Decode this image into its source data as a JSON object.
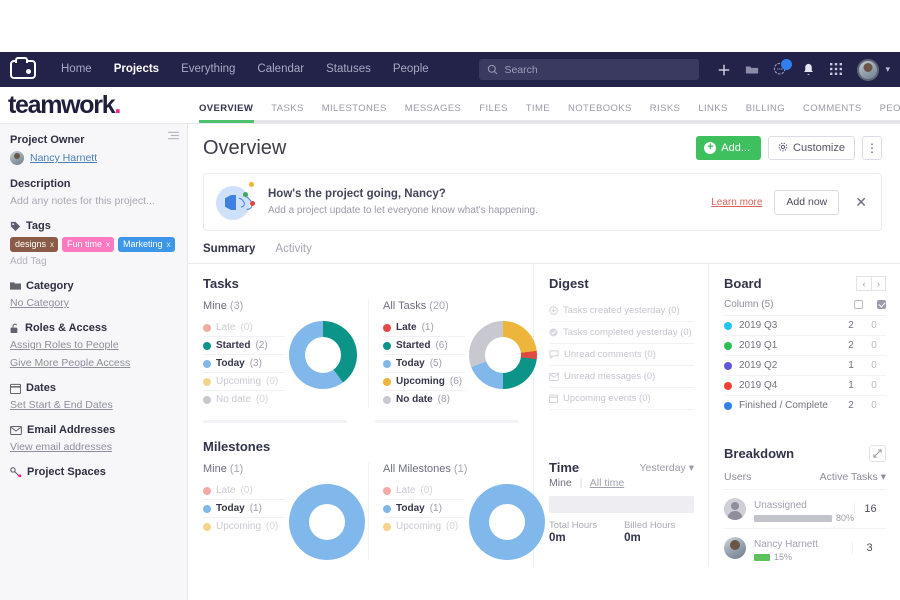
{
  "topnav": {
    "logo_icon": "teamwork-box-icon",
    "items": [
      {
        "label": "Home",
        "active": false
      },
      {
        "label": "Projects",
        "active": true
      },
      {
        "label": "Everything",
        "active": false
      },
      {
        "label": "Calendar",
        "active": false
      },
      {
        "label": "Statuses",
        "active": false
      },
      {
        "label": "People",
        "active": false
      }
    ],
    "search": {
      "placeholder": "Search",
      "value": ""
    },
    "icons": [
      "plus-icon",
      "folder-icon",
      "chat-icon",
      "bell-icon",
      "grid-apps-icon"
    ],
    "notification_badge": true
  },
  "brand": {
    "name": "teamwork",
    "dot": "."
  },
  "project_tabs": [
    {
      "label": "OVERVIEW",
      "active": true
    },
    {
      "label": "TASKS",
      "active": false
    },
    {
      "label": "MILESTONES",
      "active": false
    },
    {
      "label": "MESSAGES",
      "active": false
    },
    {
      "label": "FILES",
      "active": false
    },
    {
      "label": "TIME",
      "active": false
    },
    {
      "label": "NOTEBOOKS",
      "active": false
    },
    {
      "label": "RISKS",
      "active": false
    },
    {
      "label": "LINKS",
      "active": false
    },
    {
      "label": "BILLING",
      "active": false
    },
    {
      "label": "COMMENTS",
      "active": false
    },
    {
      "label": "PEOPLE",
      "active": false
    },
    {
      "label": "•••",
      "active": false
    }
  ],
  "sidebar": {
    "project_owner": {
      "heading": "Project Owner",
      "name": "Nancy Harnett"
    },
    "description": {
      "heading": "Description",
      "placeholder": "Add any notes for this project..."
    },
    "tags": {
      "heading": "Tags",
      "items": [
        {
          "label": "designs",
          "color": "#8a5c48"
        },
        {
          "label": "Fun time",
          "color": "#fb79bf"
        },
        {
          "label": "Marketing",
          "color": "#3d97e8"
        }
      ],
      "add_label": "Add Tag"
    },
    "category": {
      "heading": "Category",
      "value": "No Category"
    },
    "roles": {
      "heading": "Roles & Access",
      "links": [
        "Assign Roles to People",
        "Give More People Access"
      ]
    },
    "dates": {
      "heading": "Dates",
      "links": [
        "Set Start & End Dates"
      ]
    },
    "email": {
      "heading": "Email Addresses",
      "links": [
        "View email addresses"
      ]
    },
    "spaces": {
      "heading": "Project Spaces"
    }
  },
  "page": {
    "title": "Overview",
    "add_label": "Add...",
    "customize_label": "Customize",
    "kebab_label": "⋮"
  },
  "banner": {
    "title": "How's the project going, Nancy?",
    "subtitle": "Add a project update to let everyone know what's happening.",
    "learn_more": "Learn more",
    "add_now": "Add now",
    "close": "✕"
  },
  "summary_tabs": [
    {
      "label": "Summary",
      "active": true
    },
    {
      "label": "Activity",
      "active": false
    }
  ],
  "chart_data": [
    {
      "type": "pie",
      "title": "Tasks",
      "subtitle": "Mine",
      "total_label": "(3)",
      "categories": [
        "Late",
        "Started",
        "Today",
        "Upcoming",
        "No date"
      ],
      "values": [
        0,
        2,
        3,
        0,
        0
      ],
      "colors": [
        "#f3a9a4",
        "#0c9488",
        "#81b8ec",
        "#f5d48b",
        "#c8c8d0"
      ],
      "legend": "left",
      "donut": true
    },
    {
      "type": "pie",
      "title": "Tasks",
      "subtitle": "All Tasks",
      "total_label": "(20)",
      "categories": [
        "Late",
        "Started",
        "Today",
        "Upcoming",
        "No date"
      ],
      "values": [
        1,
        6,
        5,
        6,
        8
      ],
      "colors": [
        "#e04a42",
        "#0c9488",
        "#81b8ec",
        "#edb53c",
        "#c8c8d0"
      ],
      "legend": "left",
      "donut": true
    },
    {
      "type": "pie",
      "title": "Milestones",
      "subtitle": "Mine",
      "total_label": "(1)",
      "categories": [
        "Late",
        "Today",
        "Upcoming"
      ],
      "values": [
        0,
        1,
        0
      ],
      "colors": [
        "#f3a9a4",
        "#81b8ec",
        "#f5d48b"
      ],
      "legend": "left",
      "donut": true
    },
    {
      "type": "pie",
      "title": "Milestones",
      "subtitle": "All Milestones",
      "total_label": "(1)",
      "categories": [
        "Late",
        "Today",
        "Upcoming"
      ],
      "values": [
        0,
        1,
        0
      ],
      "colors": [
        "#f3a9a4",
        "#81b8ec",
        "#f5d48b"
      ],
      "legend": "left",
      "donut": true
    }
  ],
  "tasks": {
    "title": "Tasks",
    "mine": {
      "label": "Mine",
      "count": "(3)",
      "rows": [
        {
          "name": "Late",
          "value": "(0)",
          "color": "#f3a9a4",
          "active": false
        },
        {
          "name": "Started",
          "value": "(2)",
          "color": "#0c9488",
          "active": true
        },
        {
          "name": "Today",
          "value": "(3)",
          "color": "#81b8ec",
          "active": true
        },
        {
          "name": "Upcoming",
          "value": "(0)",
          "color": "#f5d48b",
          "active": false
        },
        {
          "name": "No date",
          "value": "(0)",
          "color": "#c8c8d0",
          "active": false
        }
      ]
    },
    "all": {
      "label": "All Tasks",
      "count": "(20)",
      "rows": [
        {
          "name": "Late",
          "value": "(1)",
          "color": "#e04a42",
          "active": true
        },
        {
          "name": "Started",
          "value": "(6)",
          "color": "#0c9488",
          "active": true
        },
        {
          "name": "Today",
          "value": "(5)",
          "color": "#81b8ec",
          "active": true
        },
        {
          "name": "Upcoming",
          "value": "(6)",
          "color": "#edb53c",
          "active": true
        },
        {
          "name": "No date",
          "value": "(8)",
          "color": "#c8c8d0",
          "active": true
        }
      ]
    }
  },
  "milestones": {
    "title": "Milestones",
    "mine": {
      "label": "Mine",
      "count": "(1)",
      "rows": [
        {
          "name": "Late",
          "value": "(0)",
          "color": "#f3a9a4",
          "active": false
        },
        {
          "name": "Today",
          "value": "(1)",
          "color": "#81b8ec",
          "active": true
        },
        {
          "name": "Upcoming",
          "value": "(0)",
          "color": "#f5d48b",
          "active": false
        }
      ]
    },
    "all": {
      "label": "All Milestones",
      "count": "(1)",
      "rows": [
        {
          "name": "Late",
          "value": "(0)",
          "color": "#f3a9a4",
          "active": false
        },
        {
          "name": "Today",
          "value": "(1)",
          "color": "#81b8ec",
          "active": true
        },
        {
          "name": "Upcoming",
          "value": "(0)",
          "color": "#f5d48b",
          "active": false
        }
      ]
    }
  },
  "digest": {
    "title": "Digest",
    "rows": [
      {
        "label": "Tasks created yesterday (0)",
        "icon": "plus-circle-icon"
      },
      {
        "label": "Tasks completed yesterday (0)",
        "icon": "check-circle-icon"
      },
      {
        "label": "Unread comments (0)",
        "icon": "comment-icon"
      },
      {
        "label": "Unread messages (0)",
        "icon": "envelope-icon"
      },
      {
        "label": "Upcoming events (0)",
        "icon": "calendar-icon"
      }
    ]
  },
  "board": {
    "title": "Board",
    "prev": "‹",
    "next": "›",
    "col_header": "Column (5)",
    "rows": [
      {
        "name": "2019 Q3",
        "color": "#23c6f0",
        "open": "2",
        "done": "0"
      },
      {
        "name": "2019 Q1",
        "color": "#2bbd56",
        "open": "2",
        "done": "0"
      },
      {
        "name": "2019 Q2",
        "color": "#6257d8",
        "open": "1",
        "done": "0"
      },
      {
        "name": "2019 Q4",
        "color": "#ef4136",
        "open": "1",
        "done": "0"
      },
      {
        "name": "Finished / Complete",
        "color": "#2f80ed",
        "open": "2",
        "done": "0"
      }
    ]
  },
  "time": {
    "title": "Time",
    "range": "Yesterday",
    "mine": "Mine",
    "all_time": "All time",
    "total_hours_label": "Total Hours",
    "total_hours_value": "0m",
    "billed_hours_label": "Billed Hours",
    "billed_hours_value": "0m"
  },
  "breakdown": {
    "title": "Breakdown",
    "users_label": "Users",
    "metric_label": "Active Tasks",
    "expand_icon": "expand-icon",
    "rows": [
      {
        "name": "Unassigned",
        "pct": "80%",
        "pct_num": 80,
        "count": "16",
        "bar_color": "#c3c3cc",
        "avatar": "unassigned-avatar"
      },
      {
        "name": "Nancy Harnett",
        "pct": "15%",
        "pct_num": 15,
        "count": "3",
        "bar_color": "#5cc35c",
        "avatar": "user-avatar"
      }
    ]
  }
}
